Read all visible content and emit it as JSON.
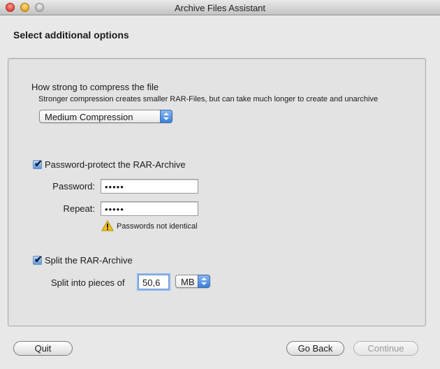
{
  "window": {
    "title": "Archive Files Assistant"
  },
  "page": {
    "title": "Select additional options"
  },
  "compression": {
    "label": "How strong to compress the file",
    "hint": "Stronger compression creates smaller RAR-Files, but can take much longer to create and unarchive",
    "selected": "Medium Compression"
  },
  "password": {
    "checkbox_label": "Password-protect the RAR-Archive",
    "checked": true,
    "password_label": "Password:",
    "password_value": "•••••",
    "repeat_label": "Repeat:",
    "repeat_value": "•••••",
    "warning": "Passwords not identical"
  },
  "split": {
    "checkbox_label": "Split the RAR-Archive",
    "checked": true,
    "pieces_label": "Split into pieces of",
    "size_value": "50,6",
    "unit": "MB"
  },
  "buttons": {
    "quit": "Quit",
    "back": "Go Back",
    "continue": "Continue"
  },
  "icons": {
    "checkmark": "✔"
  }
}
